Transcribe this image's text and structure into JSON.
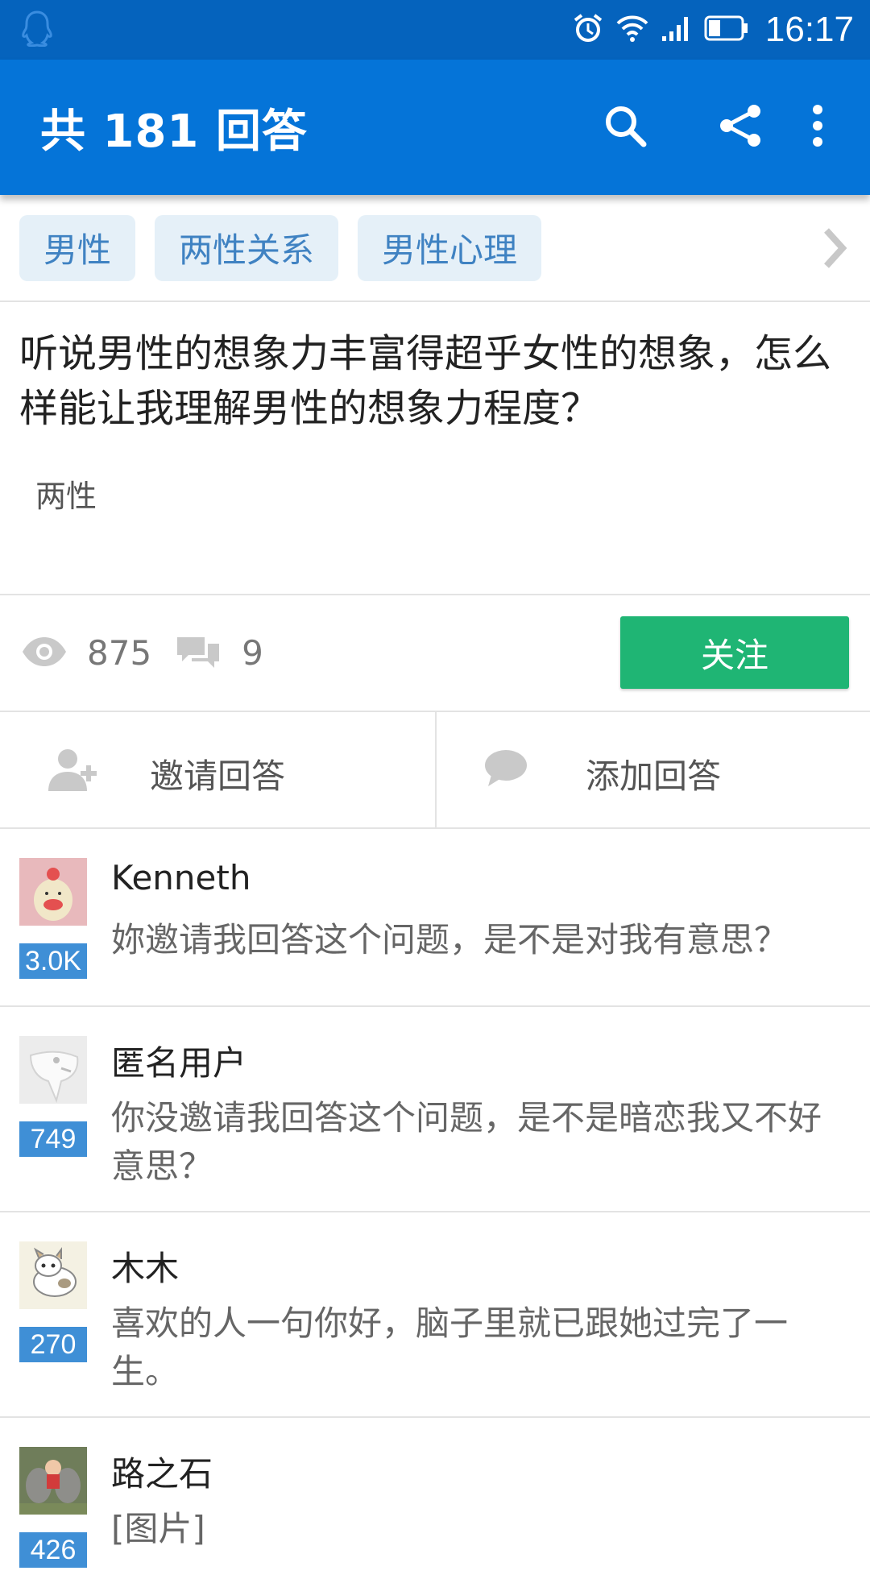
{
  "status_bar": {
    "time": "16:17"
  },
  "app_bar": {
    "title": "共 181 回答"
  },
  "tags": [
    "男性",
    "两性关系",
    "男性心理"
  ],
  "question": {
    "title": "听说男性的想象力丰富得超乎女性的想象，怎么样能让我理解男性的想象力程度？",
    "topic": "两性"
  },
  "stats": {
    "views": "875",
    "comments": "9",
    "follow_label": "关注"
  },
  "actions": {
    "invite_label": "邀请回答",
    "add_label": "添加回答"
  },
  "answers": [
    {
      "name": "Kenneth",
      "score": "3.0K",
      "text": "妳邀请我回答这个问题，是不是对我有意思？"
    },
    {
      "name": "匿名用户",
      "score": "749",
      "text": "你没邀请我回答这个问题，是不是暗恋我又不好意思？"
    },
    {
      "name": "木木",
      "score": "270",
      "text": "喜欢的人一句你好，脑子里就已跟她过完了一生。"
    },
    {
      "name": "路之石",
      "score": "426",
      "text": "[图片]"
    }
  ],
  "colors": {
    "status_bar": "#0563bd",
    "app_bar": "#0574d8",
    "follow": "#1fb574",
    "tag_bg": "#e5f0f8",
    "tag_text": "#3f82c2",
    "score_bg": "#3f8fd6"
  }
}
